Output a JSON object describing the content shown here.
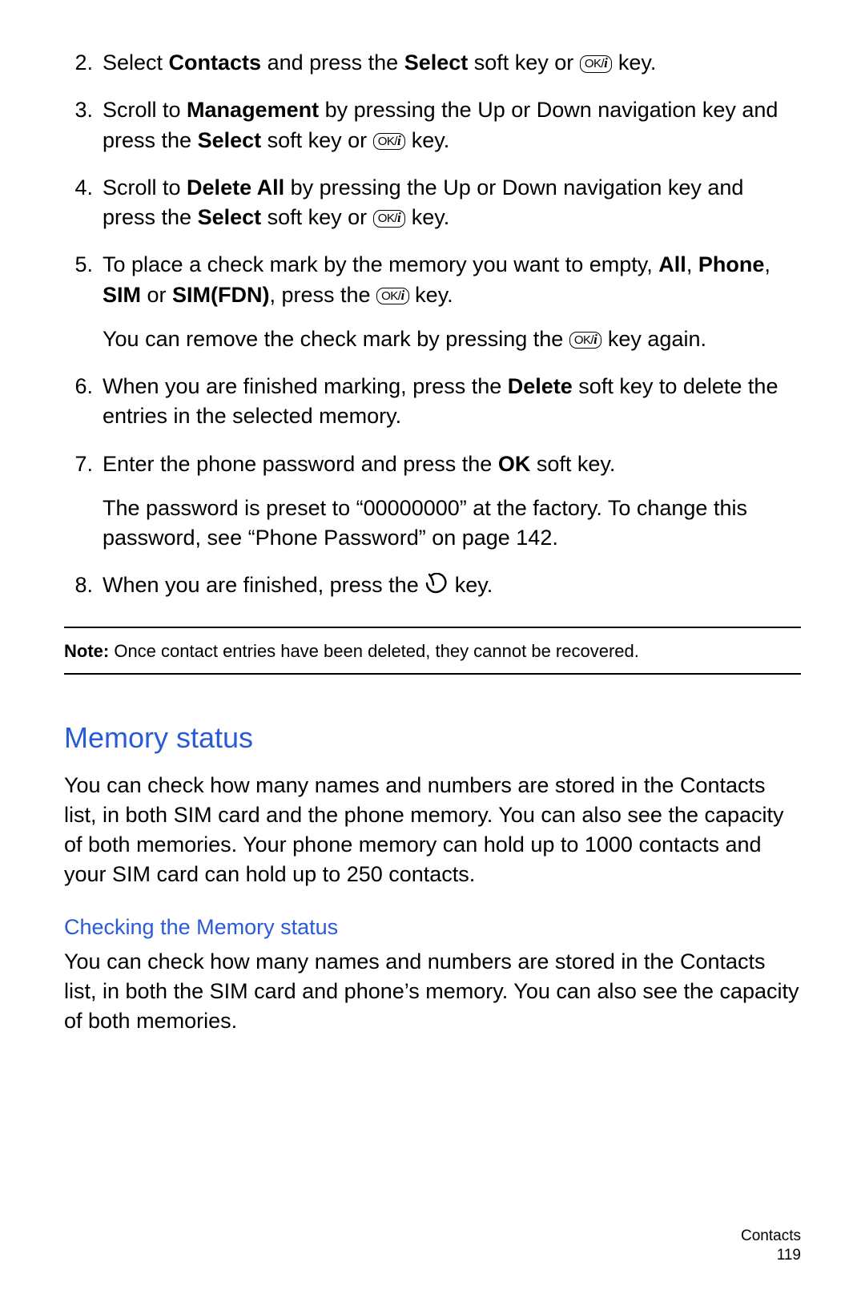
{
  "steps": [
    {
      "num": "2.",
      "paras": [
        {
          "runs": [
            {
              "t": "Select "
            },
            {
              "t": "Contacts",
              "b": true
            },
            {
              "t": " and press the "
            },
            {
              "t": "Select",
              "b": true
            },
            {
              "t": " soft key or "
            },
            {
              "key": "ok"
            },
            {
              "t": " key."
            }
          ]
        }
      ]
    },
    {
      "num": "3.",
      "paras": [
        {
          "runs": [
            {
              "t": "Scroll to "
            },
            {
              "t": "Management",
              "b": true
            },
            {
              "t": " by pressing the Up or Down navigation key and press the "
            },
            {
              "t": "Select",
              "b": true
            },
            {
              "t": " soft key or "
            },
            {
              "key": "ok"
            },
            {
              "t": " key."
            }
          ]
        }
      ]
    },
    {
      "num": "4.",
      "paras": [
        {
          "runs": [
            {
              "t": "Scroll to "
            },
            {
              "t": "Delete All",
              "b": true
            },
            {
              "t": " by pressing the Up or Down navigation key and press the "
            },
            {
              "t": "Select",
              "b": true
            },
            {
              "t": " soft key or "
            },
            {
              "key": "ok"
            },
            {
              "t": " key."
            }
          ]
        }
      ]
    },
    {
      "num": "5.",
      "paras": [
        {
          "runs": [
            {
              "t": "To place a check mark by the memory you want to empty, "
            },
            {
              "t": "All",
              "b": true
            },
            {
              "t": ", "
            },
            {
              "t": "Phone",
              "b": true
            },
            {
              "t": ", "
            },
            {
              "t": "SIM",
              "b": true
            },
            {
              "t": " or "
            },
            {
              "t": "SIM(FDN)",
              "b": true
            },
            {
              "t": ", press the "
            },
            {
              "key": "ok"
            },
            {
              "t": " key."
            }
          ]
        },
        {
          "runs": [
            {
              "t": "You can remove the check mark by pressing the "
            },
            {
              "key": "ok"
            },
            {
              "t": " key again."
            }
          ]
        }
      ]
    },
    {
      "num": "6.",
      "paras": [
        {
          "runs": [
            {
              "t": "When you are finished marking, press the "
            },
            {
              "t": "Delete",
              "b": true
            },
            {
              "t": " soft key to delete the entries in the selected memory."
            }
          ]
        }
      ]
    },
    {
      "num": "7.",
      "paras": [
        {
          "runs": [
            {
              "t": "Enter the phone password and press the "
            },
            {
              "t": "OK",
              "b": true
            },
            {
              "t": " soft key."
            }
          ]
        },
        {
          "runs": [
            {
              "t": "The password is preset to “00000000” at the factory. To change this password, see “Phone Password” on page 142."
            }
          ]
        }
      ]
    },
    {
      "num": "8.",
      "paras": [
        {
          "runs": [
            {
              "t": "When you are finished, press the "
            },
            {
              "key": "end"
            },
            {
              "t": " key."
            }
          ]
        }
      ]
    }
  ],
  "note": {
    "label": "Note:",
    "text": " Once contact entries have been deleted, they cannot be recovered."
  },
  "section_heading": "Memory status",
  "section_para": "You can check how many names and numbers are stored in the Contacts list, in both SIM card and the phone memory. You can also see the capacity of both memories. Your phone memory can hold up to 1000 contacts and your SIM card can hold up to 250 contacts.",
  "subsection_heading": "Checking the Memory status",
  "subsection_para": "You can check how many names and numbers are stored in the Contacts list, in both the SIM card and phone’s memory. You can also see the capacity of both memories.",
  "footer_section": "Contacts",
  "footer_page": "119"
}
